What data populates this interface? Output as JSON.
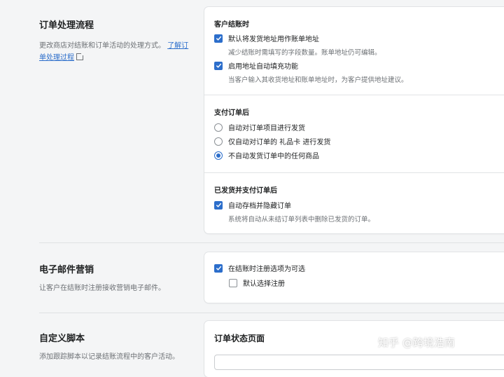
{
  "order_processing": {
    "title": "订单处理流程",
    "desc": "更改商店对结账和订单活动的处理方式。",
    "learn_more": "了解订单处理过程",
    "checkout": {
      "title": "客户结账时",
      "opt1": "默认将发货地址用作账单地址",
      "opt1_help": "减少结账时需填写的字段数量。账单地址仍可编辑。",
      "opt2": "启用地址自动填充功能",
      "opt2_help": "当客户输入其收货地址和账单地址时，为客户提供地址建议。"
    },
    "after_paid": {
      "title": "支付订单后",
      "radio1": "自动对订单项目进行发货",
      "radio2": "仅自动对订单的 礼品卡 进行发货",
      "radio3": "不自动发货订单中的任何商品"
    },
    "after_fulfilled": {
      "title": "已发货并支付订单后",
      "opt1": "自动存档并隐藏订单",
      "opt1_help": "系统将自动从未结订单列表中删除已发货的订单。"
    }
  },
  "email_marketing": {
    "title": "电子邮件营销",
    "desc": "让客户在结账时注册接收营销电子邮件。",
    "opt1": "在结账时注册选项为可选",
    "opt2": "默认选择注册"
  },
  "custom_scripts": {
    "title": "自定义脚本",
    "desc": "添加跟踪脚本以记录结账流程中的客户活动。",
    "card_title": "订单状态页面"
  },
  "watermark": "知乎 @跨境浩南",
  "colors": {
    "accent": "#2c6ecb",
    "background": "#f4f5f6"
  }
}
